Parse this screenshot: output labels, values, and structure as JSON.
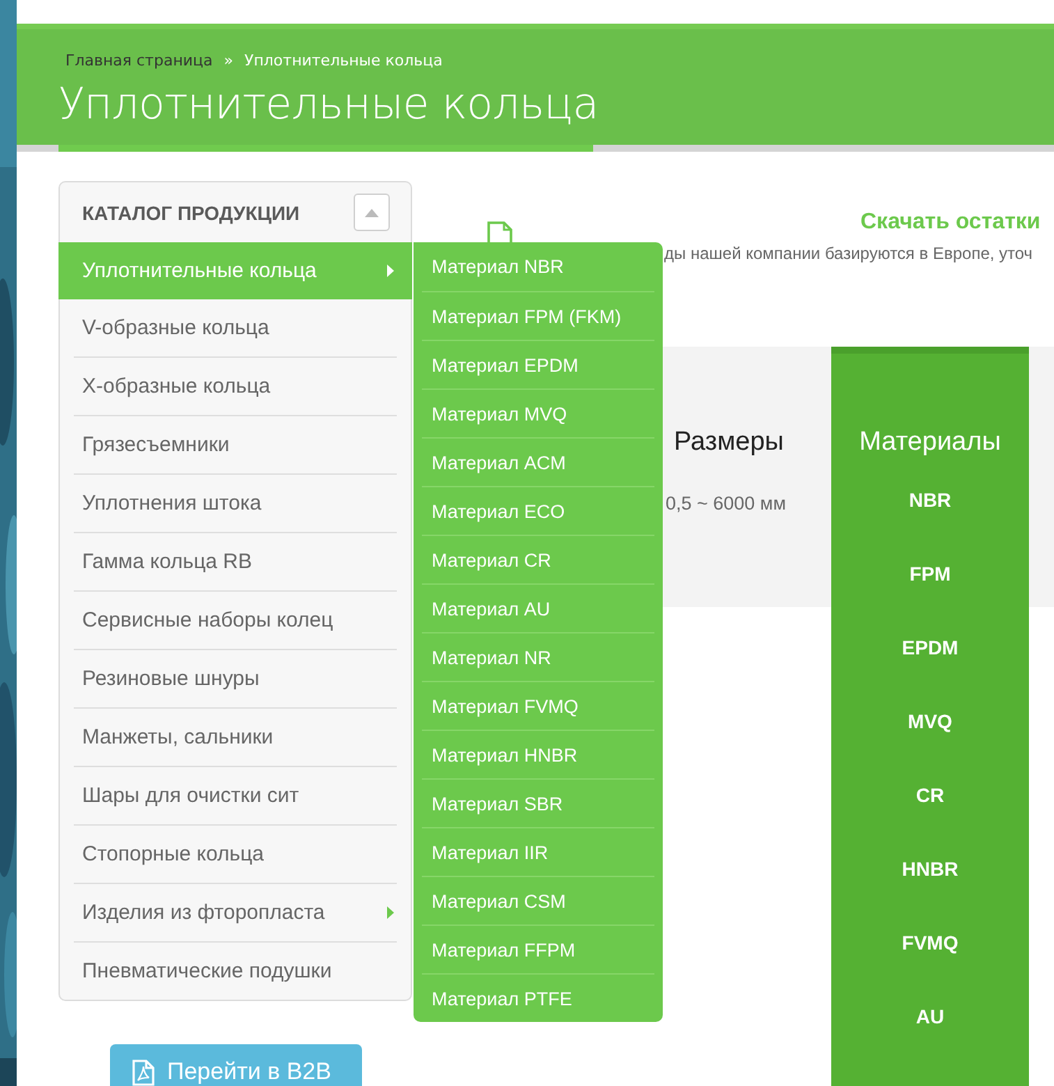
{
  "breadcrumb": [
    {
      "label": "Главная страница",
      "current": false
    },
    {
      "label": "Уплотнительные кольца",
      "current": true
    }
  ],
  "breadcrumb_separator": "»",
  "page_title": "Уплотнительные кольца",
  "catalog": {
    "title": "КАТАЛОГ ПРОДУКЦИИ",
    "expanded": true,
    "items": [
      {
        "label": "Уплотнительные кольца",
        "selected": true,
        "has_submenu": true
      },
      {
        "label": "V-образные кольца",
        "selected": false,
        "has_submenu": false
      },
      {
        "label": "X-образные кольца",
        "selected": false,
        "has_submenu": false
      },
      {
        "label": "Грязесъемники",
        "selected": false,
        "has_submenu": false
      },
      {
        "label": "Уплотнения штока",
        "selected": false,
        "has_submenu": false
      },
      {
        "label": "Гамма кольца RB",
        "selected": false,
        "has_submenu": false
      },
      {
        "label": "Сервисные наборы колец",
        "selected": false,
        "has_submenu": false
      },
      {
        "label": "Резиновые шнуры",
        "selected": false,
        "has_submenu": false
      },
      {
        "label": "Манжеты, сальники",
        "selected": false,
        "has_submenu": false
      },
      {
        "label": "Шары для очистки сит",
        "selected": false,
        "has_submenu": false
      },
      {
        "label": "Стопорные кольца",
        "selected": false,
        "has_submenu": false
      },
      {
        "label": "Изделия из фторопласта",
        "selected": false,
        "has_submenu": true
      },
      {
        "label": "Пневматические подушки",
        "selected": false,
        "has_submenu": false
      }
    ]
  },
  "submenu": {
    "items": [
      "Материал NBR",
      "Материал FPM (FKM)",
      "Материал EPDM",
      "Материал MVQ",
      "Материал ACM",
      "Материал ECO",
      "Материал CR",
      "Материал AU",
      "Материал NR",
      "Материал FVMQ",
      "Материал HNBR",
      "Материал SBR",
      "Материал IIR",
      "Материал CSM",
      "Материал FFPM",
      "Материал PTFE"
    ]
  },
  "b2b_button": "Перейти в B2B",
  "stock": {
    "link": "Скачать остатки",
    "description": "ды нашей компании базируются в Европе, уточ"
  },
  "table": {
    "sizes": {
      "heading": "Размеры",
      "value": "0,5 ~ 6000 мм"
    },
    "materials": {
      "heading": "Материалы",
      "items": [
        "NBR",
        "FPM",
        "EPDM",
        "MVQ",
        "CR",
        "HNBR",
        "FVMQ",
        "AU"
      ]
    }
  }
}
